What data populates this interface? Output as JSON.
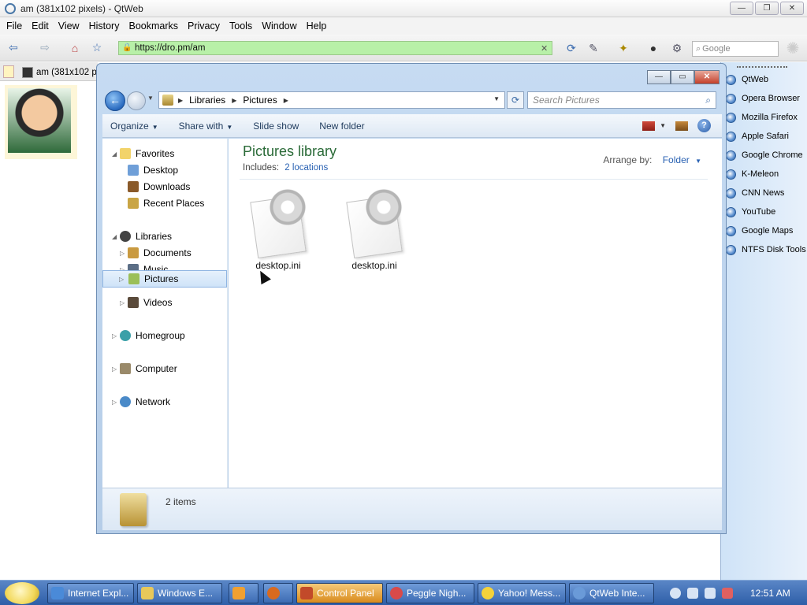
{
  "browser": {
    "title": "am (381x102 pixels) - QtWeb",
    "menu": [
      "File",
      "Edit",
      "View",
      "History",
      "Bookmarks",
      "Privacy",
      "Tools",
      "Window",
      "Help"
    ],
    "url": "https://dro.pm/am",
    "search_placeholder": "Google",
    "tab_label": "am (381x102 p"
  },
  "bookmarks": [
    "QtWeb",
    "Opera Browser",
    "Mozilla Firefox",
    "Apple Safari",
    "Google Chrome",
    "K-Meleon",
    "CNN News",
    "YouTube",
    "Google Maps",
    "NTFS Disk Tools"
  ],
  "explorer": {
    "breadcrumb": [
      "Libraries",
      "Pictures"
    ],
    "search_placeholder": "Search Pictures",
    "commands": [
      "Organize",
      "Share with",
      "Slide show",
      "New folder"
    ],
    "nav": {
      "favorites": "Favorites",
      "desktop": "Desktop",
      "downloads": "Downloads",
      "recent": "Recent Places",
      "libraries": "Libraries",
      "documents": "Documents",
      "music": "Music",
      "pictures": "Pictures",
      "videos": "Videos",
      "homegroup": "Homegroup",
      "computer": "Computer",
      "network": "Network"
    },
    "library_title": "Pictures library",
    "includes_label": "Includes:",
    "includes_link": "2 locations",
    "arrange_label": "Arrange by:",
    "arrange_value": "Folder",
    "files": [
      "desktop.ini",
      "desktop.ini"
    ],
    "status": "2 items"
  },
  "taskbar": {
    "tasks": [
      "Internet Expl...",
      "Windows E...",
      "",
      "",
      "Control Panel",
      "Peggle Nigh...",
      "Yahoo! Mess...",
      "QtWeb Inte..."
    ],
    "clock": "12:51 AM"
  }
}
